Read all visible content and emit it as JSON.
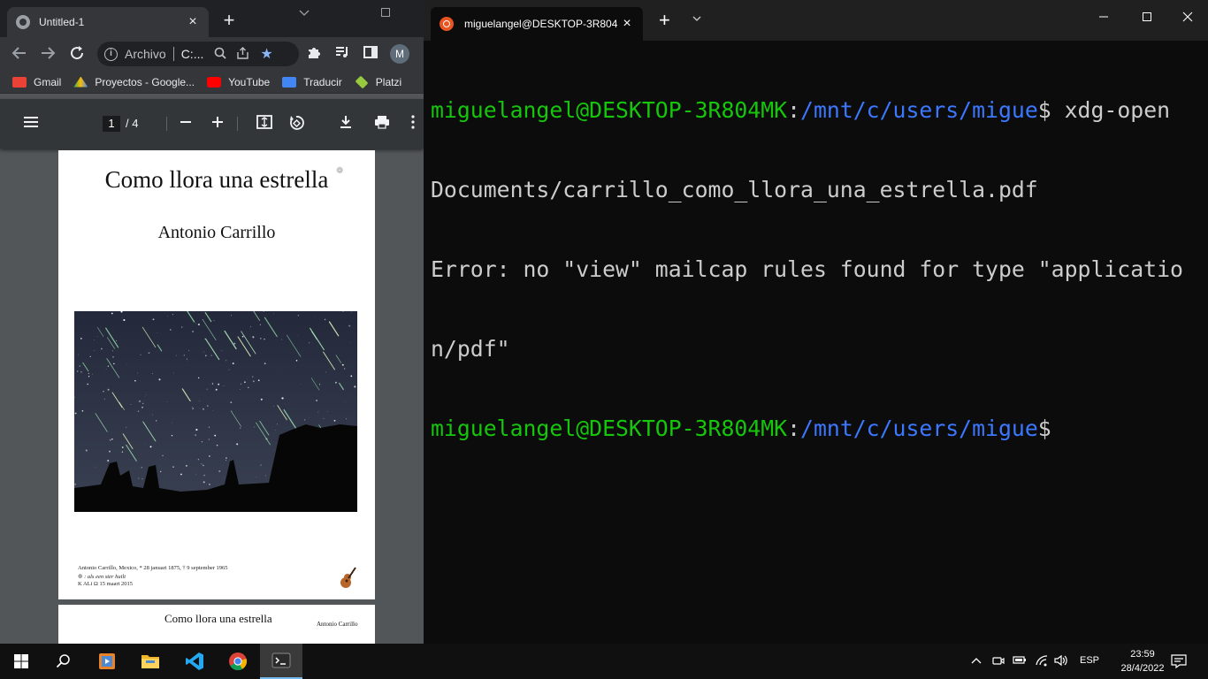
{
  "chrome": {
    "tab_title": "Untitled-1",
    "tab_close": "×",
    "new_tab": "+",
    "omnibox": {
      "scheme": "Archivo",
      "url": "C:..."
    },
    "avatar_letter": "M",
    "bookmarks": [
      {
        "label": "Gmail",
        "color": "#ea4335"
      },
      {
        "label": "Proyectos - Google...",
        "color": "#fbbc04"
      },
      {
        "label": "YouTube",
        "color": "#ff0000"
      },
      {
        "label": "Traducir",
        "color": "#4285f4"
      },
      {
        "label": "Platzi",
        "color": "#98ca3f"
      }
    ],
    "pdf": {
      "page_current": "1",
      "page_total": "/  4",
      "page1": {
        "title": "Como llora una estrella",
        "author": "Antonio Carrillo",
        "footer_line1": "Antonio Carrillo, Mexico, * 28 januari 1875, † 9 september 1965",
        "footer_line2": ": als een ster huilt",
        "footer_line3": "K ALi Ω 15 maart 2015"
      },
      "page2": {
        "title": "Como llora una estrella",
        "author": "Antonio Carrillo"
      }
    }
  },
  "terminal": {
    "tab_title": "miguelangel@DESKTOP-3R804",
    "tab_close": "×",
    "new_tab": "+",
    "lines": [
      {
        "user": "miguelangel@DESKTOP-3R804MK",
        "sep": ":",
        "path": "/mnt/c/users/migue",
        "prompt": "$",
        "cmd": " xdg-open"
      },
      {
        "text": "Documents/carrillo_como_llora_una_estrella.pdf"
      },
      {
        "text": "Error: no \"view\" mailcap rules found for type \"applicatio"
      },
      {
        "text": "n/pdf\""
      },
      {
        "user": "miguelangel@DESKTOP-3R804MK",
        "sep": ":",
        "path": "/mnt/c/users/migue",
        "prompt": "$",
        "cmd": ""
      }
    ],
    "colors": {
      "user": "#16c60c",
      "path": "#3b78ff",
      "text": "#cccccc"
    }
  },
  "taskbar": {
    "language": "ESP",
    "time": "23:59",
    "date": "28/4/2022"
  }
}
